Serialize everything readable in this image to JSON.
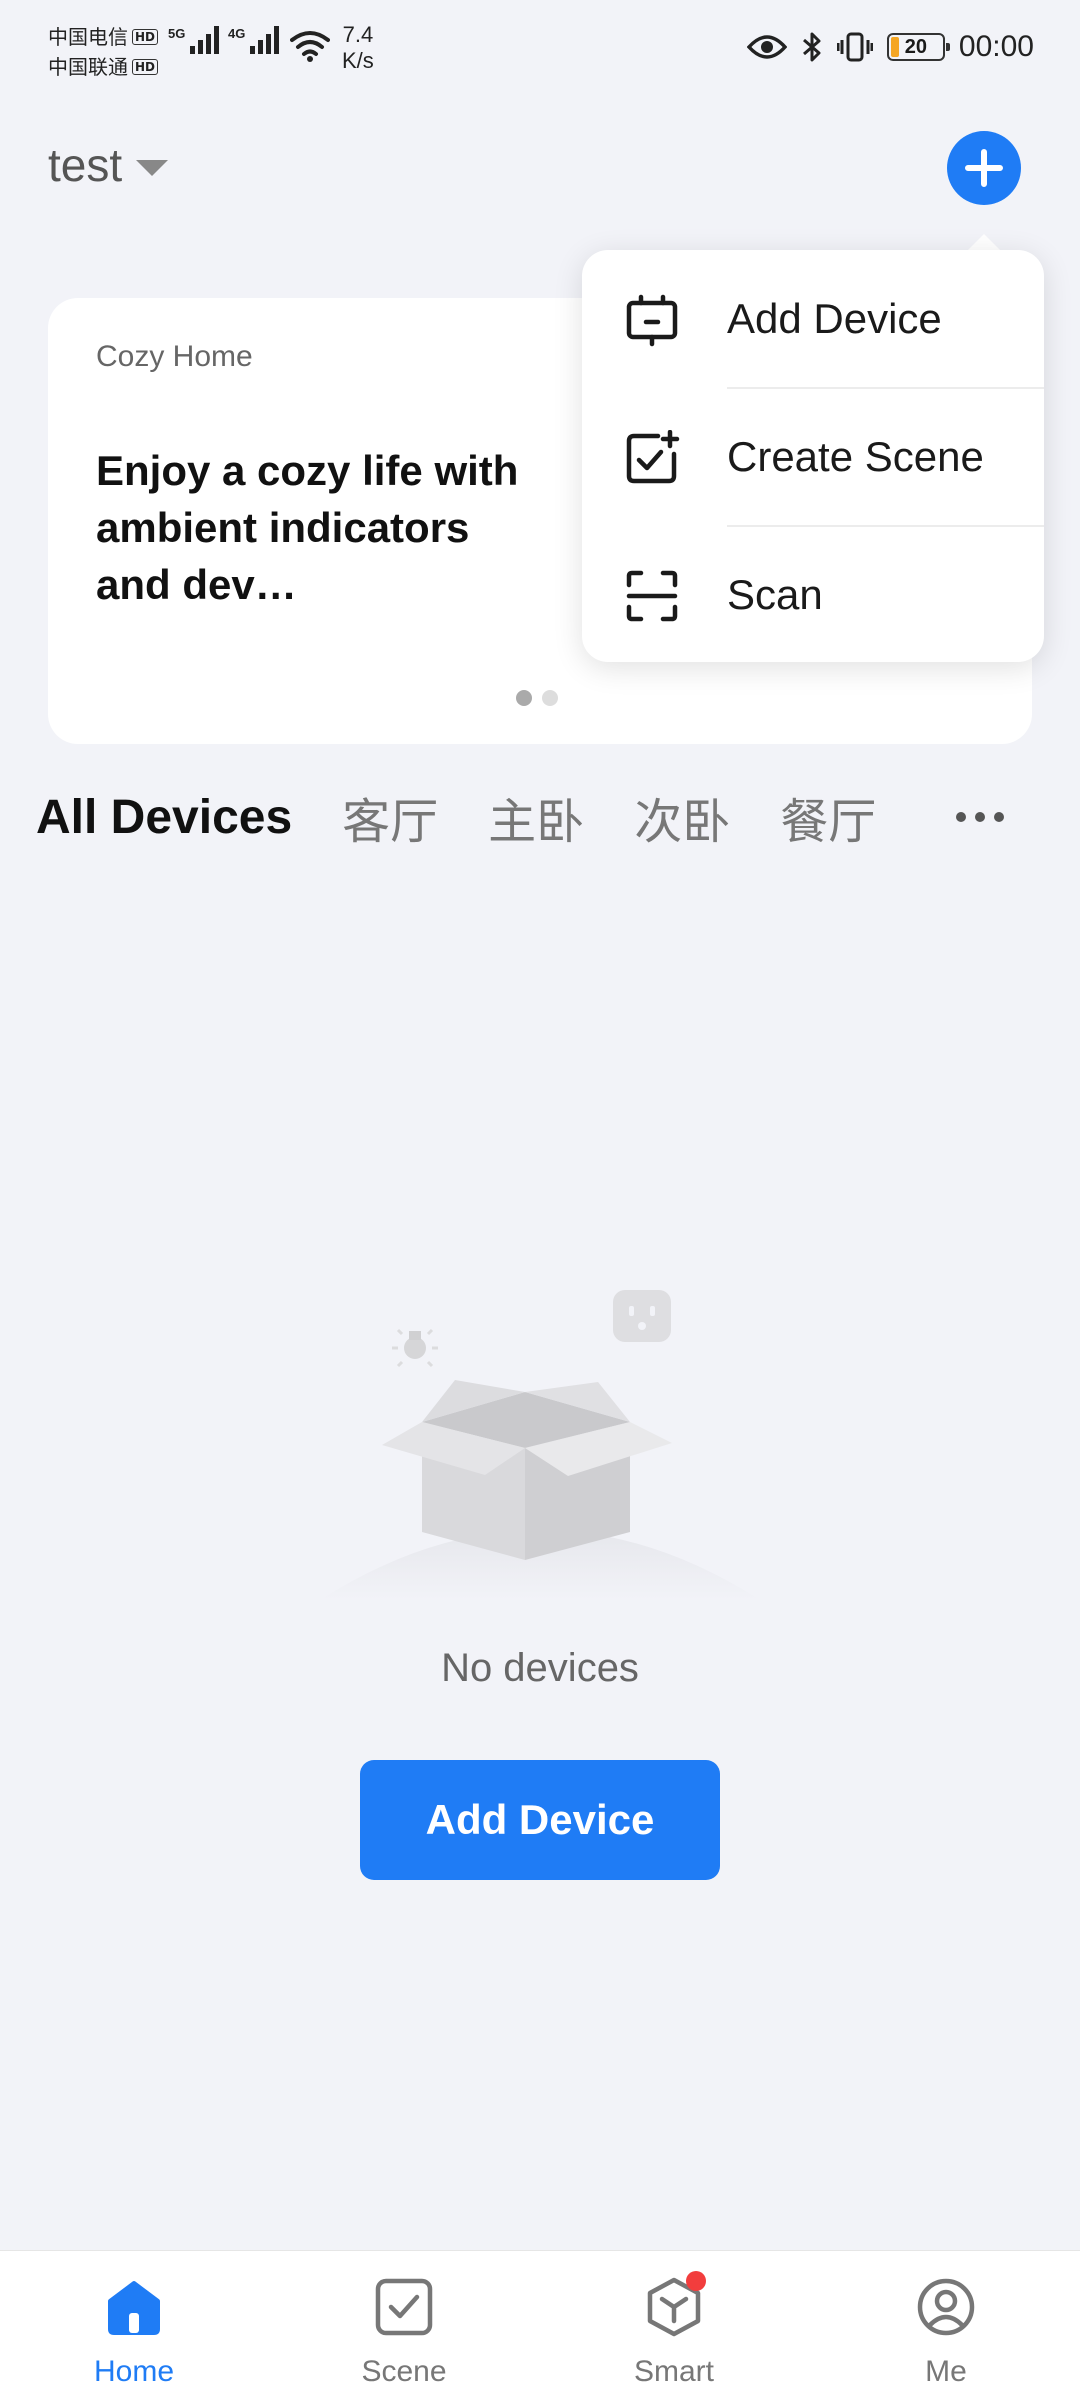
{
  "status_bar": {
    "carrier_1": "中国电信",
    "carrier_2": "中国联通",
    "hd_label": "HD",
    "network_1": "5G",
    "network_2": "4G",
    "speed_value": "7.4",
    "speed_unit": "K/s",
    "battery_level": "20",
    "time": "00:00"
  },
  "header": {
    "home_name": "test"
  },
  "banner": {
    "kicker": "Cozy Home",
    "headline": "Enjoy a cozy life with ambient indicators and dev…",
    "page_count": 2,
    "active_page": 1
  },
  "popup_menu": {
    "items": [
      {
        "label": "Add Device",
        "icon": "add-device-icon"
      },
      {
        "label": "Create Scene",
        "icon": "create-scene-icon"
      },
      {
        "label": "Scan",
        "icon": "scan-icon"
      }
    ]
  },
  "tabs": [
    "All Devices",
    "客厅",
    "主卧",
    "次卧",
    "餐厅"
  ],
  "empty_state": {
    "message": "No devices",
    "button_label": "Add Device"
  },
  "bottom_nav": {
    "items": [
      {
        "label": "Home",
        "icon": "home-icon",
        "active": true
      },
      {
        "label": "Scene",
        "icon": "scene-icon",
        "active": false
      },
      {
        "label": "Smart",
        "icon": "smart-icon",
        "active": false,
        "badge": true
      },
      {
        "label": "Me",
        "icon": "profile-icon",
        "active": false
      }
    ]
  },
  "colors": {
    "accent": "#1f7cf5",
    "background": "#f2f3f8",
    "badge": "#f23d3d"
  }
}
